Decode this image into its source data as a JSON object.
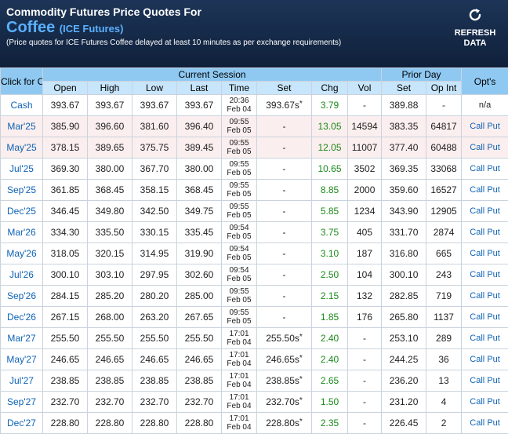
{
  "header": {
    "title": "Commodity Futures Price Quotes For",
    "commodity": "Coffee",
    "exchange": "(ICE Futures)",
    "note": "(Price quotes for ICE Futures Coffee delayed at least 10 minutes as per exchange requirements)",
    "refresh_line1": "REFRESH",
    "refresh_line2": "DATA"
  },
  "table": {
    "click_label": "Click for Chart",
    "group_current": "Current Session",
    "group_prior": "Prior Day",
    "group_opts": "Opt's",
    "cols": [
      "Open",
      "High",
      "Low",
      "Last",
      "Time",
      "Set",
      "Chg",
      "Vol",
      "Set",
      "Op Int"
    ],
    "rows": [
      {
        "sym": "Cash",
        "open": "393.67",
        "high": "393.67",
        "low": "393.67",
        "last": "393.67",
        "time1": "20:36",
        "time2": "Feb 04",
        "set": "393.67s",
        "star": "*",
        "chg": "3.79",
        "vol": "-",
        "pset": "389.88",
        "opint": "-",
        "opts": "n/a",
        "alt": false
      },
      {
        "sym": "Mar'25",
        "open": "385.90",
        "high": "396.60",
        "low": "381.60",
        "last": "396.40",
        "time1": "09:55",
        "time2": "Feb 05",
        "set": "-",
        "star": "",
        "chg": "13.05",
        "vol": "14594",
        "pset": "383.35",
        "opint": "64817",
        "opts": "CallPut",
        "alt": true
      },
      {
        "sym": "May'25",
        "open": "378.15",
        "high": "389.65",
        "low": "375.75",
        "last": "389.45",
        "time1": "09:55",
        "time2": "Feb 05",
        "set": "-",
        "star": "",
        "chg": "12.05",
        "vol": "11007",
        "pset": "377.40",
        "opint": "60488",
        "opts": "CallPut",
        "alt": true
      },
      {
        "sym": "Jul'25",
        "open": "369.30",
        "high": "380.00",
        "low": "367.70",
        "last": "380.00",
        "time1": "09:55",
        "time2": "Feb 05",
        "set": "-",
        "star": "",
        "chg": "10.65",
        "vol": "3502",
        "pset": "369.35",
        "opint": "33068",
        "opts": "CallPut",
        "alt": false
      },
      {
        "sym": "Sep'25",
        "open": "361.85",
        "high": "368.45",
        "low": "358.15",
        "last": "368.45",
        "time1": "09:55",
        "time2": "Feb 05",
        "set": "-",
        "star": "",
        "chg": "8.85",
        "vol": "2000",
        "pset": "359.60",
        "opint": "16527",
        "opts": "CallPut",
        "alt": false
      },
      {
        "sym": "Dec'25",
        "open": "346.45",
        "high": "349.80",
        "low": "342.50",
        "last": "349.75",
        "time1": "09:55",
        "time2": "Feb 05",
        "set": "-",
        "star": "",
        "chg": "5.85",
        "vol": "1234",
        "pset": "343.90",
        "opint": "12905",
        "opts": "CallPut",
        "alt": false
      },
      {
        "sym": "Mar'26",
        "open": "334.30",
        "high": "335.50",
        "low": "330.15",
        "last": "335.45",
        "time1": "09:54",
        "time2": "Feb 05",
        "set": "-",
        "star": "",
        "chg": "3.75",
        "vol": "405",
        "pset": "331.70",
        "opint": "2874",
        "opts": "CallPut",
        "alt": false
      },
      {
        "sym": "May'26",
        "open": "318.05",
        "high": "320.15",
        "low": "314.95",
        "last": "319.90",
        "time1": "09:54",
        "time2": "Feb 05",
        "set": "-",
        "star": "",
        "chg": "3.10",
        "vol": "187",
        "pset": "316.80",
        "opint": "665",
        "opts": "CallPut",
        "alt": false
      },
      {
        "sym": "Jul'26",
        "open": "300.10",
        "high": "303.10",
        "low": "297.95",
        "last": "302.60",
        "time1": "09:54",
        "time2": "Feb 05",
        "set": "-",
        "star": "",
        "chg": "2.50",
        "vol": "104",
        "pset": "300.10",
        "opint": "243",
        "opts": "CallPut",
        "alt": false
      },
      {
        "sym": "Sep'26",
        "open": "284.15",
        "high": "285.20",
        "low": "280.20",
        "last": "285.00",
        "time1": "09:55",
        "time2": "Feb 05",
        "set": "-",
        "star": "",
        "chg": "2.15",
        "vol": "132",
        "pset": "282.85",
        "opint": "719",
        "opts": "CallPut",
        "alt": false
      },
      {
        "sym": "Dec'26",
        "open": "267.15",
        "high": "268.00",
        "low": "263.20",
        "last": "267.65",
        "time1": "09:55",
        "time2": "Feb 05",
        "set": "-",
        "star": "",
        "chg": "1.85",
        "vol": "176",
        "pset": "265.80",
        "opint": "1137",
        "opts": "CallPut",
        "alt": false
      },
      {
        "sym": "Mar'27",
        "open": "255.50",
        "high": "255.50",
        "low": "255.50",
        "last": "255.50",
        "time1": "17:01",
        "time2": "Feb 04",
        "set": "255.50s",
        "star": "*",
        "chg": "2.40",
        "vol": "-",
        "pset": "253.10",
        "opint": "289",
        "opts": "CallPut",
        "alt": false
      },
      {
        "sym": "May'27",
        "open": "246.65",
        "high": "246.65",
        "low": "246.65",
        "last": "246.65",
        "time1": "17:01",
        "time2": "Feb 04",
        "set": "246.65s",
        "star": "*",
        "chg": "2.40",
        "vol": "-",
        "pset": "244.25",
        "opint": "36",
        "opts": "CallPut",
        "alt": false
      },
      {
        "sym": "Jul'27",
        "open": "238.85",
        "high": "238.85",
        "low": "238.85",
        "last": "238.85",
        "time1": "17:01",
        "time2": "Feb 04",
        "set": "238.85s",
        "star": "*",
        "chg": "2.65",
        "vol": "-",
        "pset": "236.20",
        "opint": "13",
        "opts": "CallPut",
        "alt": false
      },
      {
        "sym": "Sep'27",
        "open": "232.70",
        "high": "232.70",
        "low": "232.70",
        "last": "232.70",
        "time1": "17:01",
        "time2": "Feb 04",
        "set": "232.70s",
        "star": "*",
        "chg": "1.50",
        "vol": "-",
        "pset": "231.20",
        "opint": "4",
        "opts": "CallPut",
        "alt": false
      },
      {
        "sym": "Dec'27",
        "open": "228.80",
        "high": "228.80",
        "low": "228.80",
        "last": "228.80",
        "time1": "17:01",
        "time2": "Feb 04",
        "set": "228.80s",
        "star": "*",
        "chg": "2.35",
        "vol": "-",
        "pset": "226.45",
        "opint": "2",
        "opts": "CallPut",
        "alt": false
      }
    ],
    "call_label": "Call",
    "put_label": "Put"
  }
}
